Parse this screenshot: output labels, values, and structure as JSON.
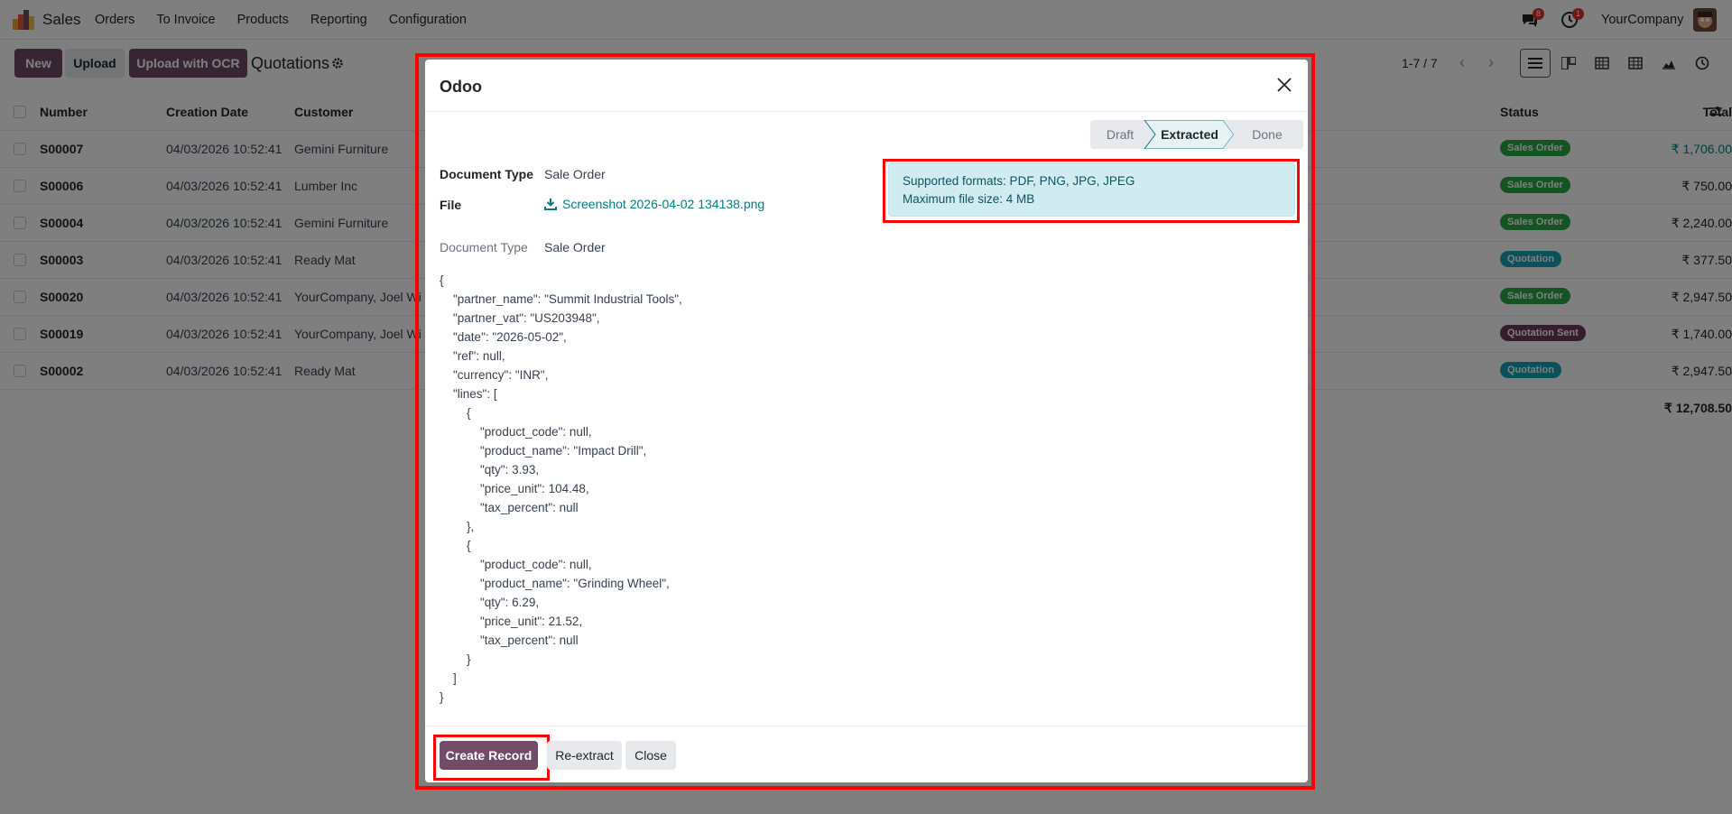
{
  "navbar": {
    "app_name": "Sales",
    "menu": [
      "Orders",
      "To Invoice",
      "Products",
      "Reporting",
      "Configuration"
    ],
    "messages_count": "8",
    "activities_count": "1",
    "company": "YourCompany"
  },
  "control_panel": {
    "new_label": "New",
    "upload_label": "Upload",
    "upload_ocr_label": "Upload with OCR",
    "title": "Quotations",
    "pager": "1-7 / 7"
  },
  "list": {
    "headers": {
      "number": "Number",
      "creation_date": "Creation Date",
      "customer": "Customer",
      "total": "Total",
      "status": "Status"
    },
    "rows": [
      {
        "number": "S00007",
        "date": "04/03/2026 10:52:41",
        "customer": "Gemini Furniture",
        "total": "₹ 1,706.00",
        "status": "Sales Order"
      },
      {
        "number": "S00006",
        "date": "04/03/2026 10:52:41",
        "customer": "Lumber Inc",
        "total": "₹ 750.00",
        "status": "Sales Order"
      },
      {
        "number": "S00004",
        "date": "04/03/2026 10:52:41",
        "customer": "Gemini Furniture",
        "total": "₹ 2,240.00",
        "status": "Sales Order"
      },
      {
        "number": "S00003",
        "date": "04/03/2026 10:52:41",
        "customer": "Ready Mat",
        "total": "₹ 377.50",
        "status": "Quotation"
      },
      {
        "number": "S00020",
        "date": "04/03/2026 10:52:41",
        "customer": "YourCompany, Joel Wi",
        "total": "₹ 2,947.50",
        "status": "Sales Order"
      },
      {
        "number": "S00019",
        "date": "04/03/2026 10:52:41",
        "customer": "YourCompany, Joel Wi",
        "total": "₹ 1,740.00",
        "status": "Quotation Sent"
      },
      {
        "number": "S00002",
        "date": "04/03/2026 10:52:41",
        "customer": "Ready Mat",
        "total": "₹ 2,947.50",
        "status": "Quotation"
      }
    ],
    "grand_total": "₹ 12,708.50"
  },
  "colors": {
    "sales_order": "#28a745",
    "quotation": "#17a2b8",
    "quotation_sent": "#6c3a59",
    "primary": "#714b67"
  },
  "modal": {
    "title": "Odoo",
    "stages": [
      "Draft",
      "Extracted",
      "Done"
    ],
    "document_type_label": "Document Type",
    "document_type_value": "Sale Order",
    "file_label": "File",
    "file_name": "Screenshot 2026-04-02 134138.png",
    "document_type_label_2": "Document Type",
    "document_type_value_2": "Sale Order",
    "info_line1": "Supported formats: PDF, PNG, JPG, JPEG",
    "info_line2": "Maximum file size: 4 MB",
    "json_text": "{\n    \"partner_name\": \"Summit Industrial Tools\",\n    \"partner_vat\": \"US203948\",\n    \"date\": \"2026-05-02\",\n    \"ref\": null,\n    \"currency\": \"INR\",\n    \"lines\": [\n        {\n            \"product_code\": null,\n            \"product_name\": \"Impact Drill\",\n            \"qty\": 3.93,\n            \"price_unit\": 104.48,\n            \"tax_percent\": null\n        },\n        {\n            \"product_code\": null,\n            \"product_name\": \"Grinding Wheel\",\n            \"qty\": 6.29,\n            \"price_unit\": 21.52,\n            \"tax_percent\": null\n        }\n    ]\n}",
    "create_label": "Create Record",
    "reextract_label": "Re-extract",
    "close_label": "Close"
  }
}
